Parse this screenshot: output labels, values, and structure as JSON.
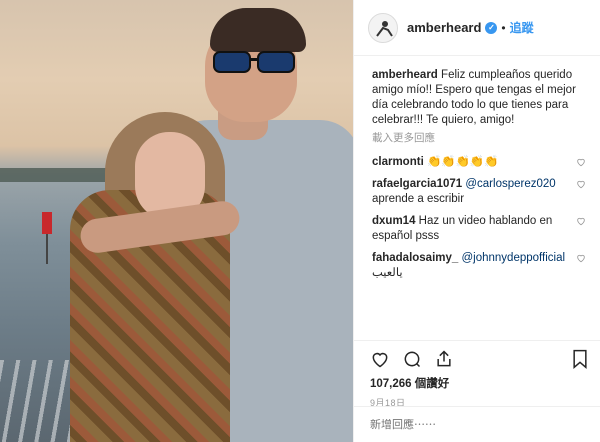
{
  "post": {
    "username": "amberheard",
    "follow_label": "追蹤",
    "caption": "Feliz cumpleaños querido amigo mío!! Espero que tengas el mejor día celebrando todo lo que tienes para celebrar!!! Te quiero, amigo!",
    "load_more": "載入更多回應",
    "likes": "107,266 個讚好",
    "date": "9月18日",
    "add_comment_placeholder": "新增回應⋯⋯"
  },
  "comments": [
    {
      "user": "clarmonti",
      "text": "👏👏👏👏👏",
      "mention": ""
    },
    {
      "user": "rafaelgarcia1071",
      "text": "aprende a escribir",
      "mention": "@carlosperez020"
    },
    {
      "user": "dxum14",
      "text": "Haz un video hablando en español psss",
      "mention": ""
    },
    {
      "user": "fahadalosaimy_",
      "text": "يالعيب",
      "mention": "@johnnydepp​official"
    }
  ],
  "icons": [
    "verified-badge-icon",
    "heart-icon",
    "comment-icon",
    "share-icon",
    "bookmark-icon"
  ],
  "colors": {
    "accent": "#3897f0",
    "text": "#262626",
    "muted": "#999999"
  }
}
